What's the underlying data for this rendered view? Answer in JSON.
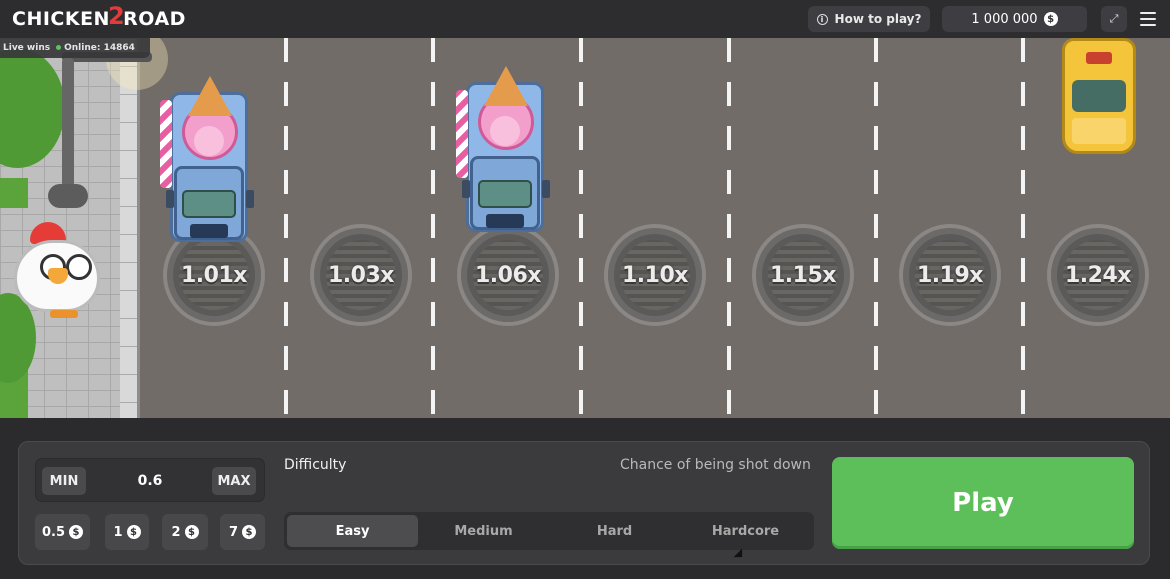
{
  "header": {
    "logo_text": "CHICKEN",
    "logo_two": "2",
    "logo_text2": "ROAD",
    "how_to_play": "How to play?",
    "balance": "1 000 000",
    "currency_symbol": "$"
  },
  "live": {
    "live_wins": "Live wins",
    "online": "Online: 14864"
  },
  "lanes": {
    "multipliers": [
      "1.01x",
      "1.03x",
      "1.06x",
      "1.10x",
      "1.15x",
      "1.19x",
      "1.24x"
    ]
  },
  "bet": {
    "min_label": "MIN",
    "value": "0.6",
    "max_label": "MAX",
    "quick_amounts": [
      "0.5",
      "1",
      "2",
      "7"
    ]
  },
  "difficulty": {
    "label": "Difficulty",
    "chance_label": "Chance of being shot down",
    "options": [
      "Easy",
      "Medium",
      "Hard",
      "Hardcore"
    ],
    "selected": "Easy"
  },
  "play_label": "Play",
  "colors": {
    "play_green": "#5cbf5a",
    "road": "#716c68",
    "panel": "#3b3b3e"
  }
}
